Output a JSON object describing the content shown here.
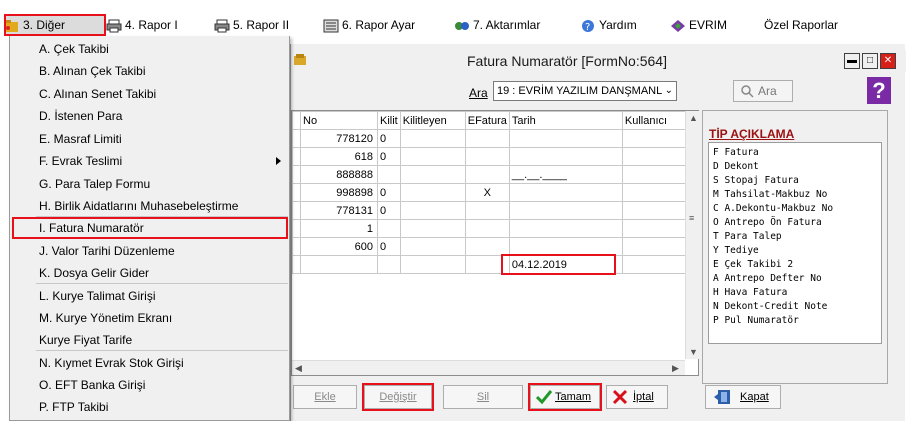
{
  "menubar": {
    "items": [
      {
        "label": "3.  Diğer",
        "icon": "folder-icon"
      },
      {
        "label": "4.  Rapor I",
        "icon": "printer-icon"
      },
      {
        "label": "5.  Rapor II",
        "icon": "printer-icon"
      },
      {
        "label": "6.  Rapor Ayar",
        "icon": "report-settings-icon"
      },
      {
        "label": "7.  Aktarımlar",
        "icon": "transfer-icon"
      },
      {
        "label": "Yardım",
        "icon": "help-icon"
      },
      {
        "label": "EVRIM",
        "icon": "evrim-logo-icon"
      },
      {
        "label": "Özel Raporlar",
        "icon": ""
      }
    ]
  },
  "dropdown": {
    "items": [
      "A.  Çek Takibi",
      "B.  Alınan Çek Takibi",
      "C.  Alınan Senet Takibi",
      "D.  İstenen Para",
      "E.  Masraf Limiti",
      "F.  Evrak Teslimi",
      "G.  Para Talep Formu",
      "H.  Birlik Aidatlarını Muhasebeleştirme",
      "I.  Fatura Numaratör",
      "J.  Valor Tarihi Düzenleme",
      "K.  Dosya Gelir Gider",
      "L.  Kurye Talimat Girişi",
      "M.  Kurye Yönetim Ekranı",
      "Kurye Fiyat Tarife",
      "N.  Kıymet Evrak Stok Girişi",
      "O.  EFT Banka Girişi",
      "P.  FTP Takibi"
    ]
  },
  "window": {
    "title": "Fatura Numaratör [FormNo:564]",
    "controls": {
      "minimize": "▬",
      "maximize": "□",
      "close": "✕"
    },
    "search": {
      "label": "Ara",
      "selected": "19 : EVRİM YAZILIM DANŞMANL",
      "button": "Ara"
    },
    "help_glyph": "?"
  },
  "grid": {
    "columns": [
      "No",
      "Kilit",
      "Kilitleyen",
      "EFatura",
      "Tarih",
      "Kullanıcı"
    ],
    "rows": [
      {
        "no": "778120",
        "kilit": "0",
        "kilitleyen": "",
        "efatura": "",
        "tarih": "",
        "kullanici": ""
      },
      {
        "no": "618",
        "kilit": "0",
        "kilitleyen": "",
        "efatura": "",
        "tarih": "",
        "kullanici": ""
      },
      {
        "no": "888888",
        "kilit": "",
        "kilitleyen": "",
        "efatura": "",
        "tarih": "__.__.____",
        "kullanici": ""
      },
      {
        "no": "998898",
        "kilit": "0",
        "kilitleyen": "",
        "efatura": "X",
        "tarih": "",
        "kullanici": ""
      },
      {
        "no": "778131",
        "kilit": "0",
        "kilitleyen": "",
        "efatura": "",
        "tarih": "",
        "kullanici": ""
      },
      {
        "no": "1",
        "kilit": "",
        "kilitleyen": "",
        "efatura": "",
        "tarih": "",
        "kullanici": ""
      },
      {
        "no": "600",
        "kilit": "0",
        "kilitleyen": "",
        "efatura": "",
        "tarih": "",
        "kullanici": ""
      },
      {
        "no": "",
        "kilit": "",
        "kilitleyen": "",
        "efatura": "",
        "tarih": "04.12.2019",
        "kullanici": ""
      }
    ]
  },
  "legend": {
    "title": "TİP AÇIKLAMA",
    "lines": [
      "F Fatura",
      "D Dekont",
      "S Stopaj Fatura",
      "M Tahsilat-Makbuz No",
      "C A.Dekontu-Makbuz No",
      "O Antrepo Ön Fatura",
      "T Para Talep",
      "Y Tediye",
      "E Çek Takibi 2",
      "A Antrepo Defter No",
      "H Hava Fatura",
      "N Dekont-Credit Note",
      "P Pul Numaratör"
    ]
  },
  "buttons": {
    "ekle": "Ekle",
    "degistir": "Değiştir",
    "sil": "Sil",
    "tamam": "Tamam",
    "iptal": "İptal",
    "kapat": "Kapat"
  },
  "colors": {
    "highlight": "#e8101a",
    "legend_title": "#9b1010",
    "help_icon_bg": "#7b2aa6",
    "ok_check": "#1f9a2a",
    "cancel_x": "#d8101a"
  }
}
